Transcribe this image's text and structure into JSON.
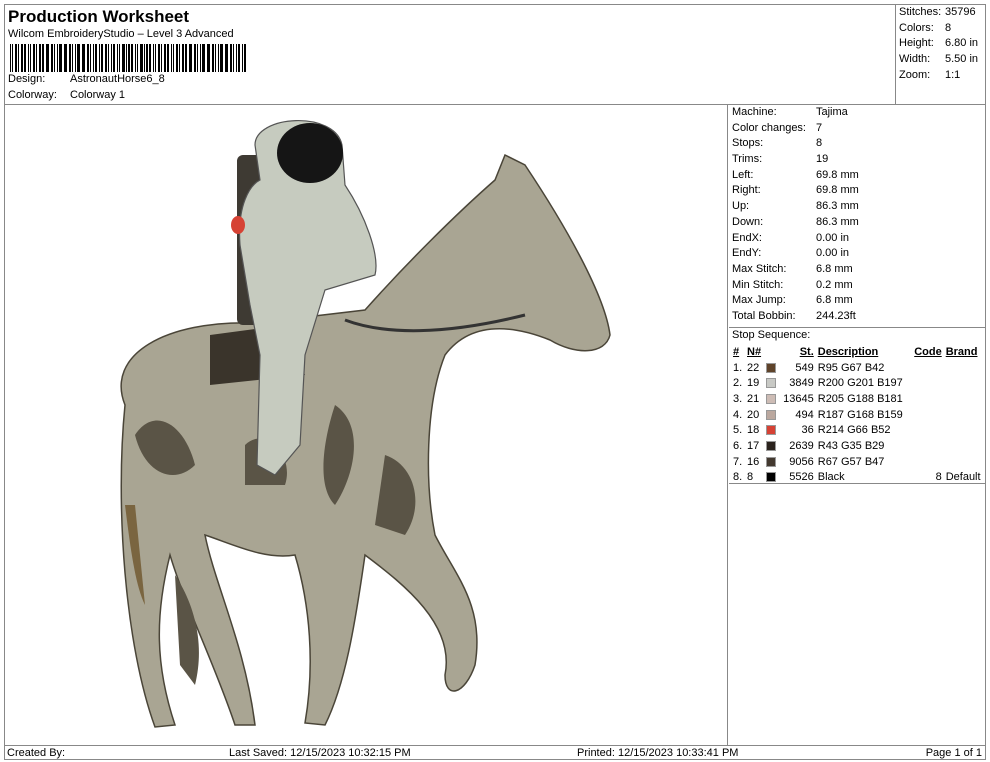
{
  "header": {
    "title": "Production Worksheet",
    "subtitle": "Wilcom EmbroideryStudio – Level 3 Advanced",
    "design_label": "Design:",
    "design": "AstronautHorse6_8",
    "colorway_label": "Colorway:",
    "colorway": "Colorway 1"
  },
  "stats": [
    {
      "k": "Stitches:",
      "v": "35796"
    },
    {
      "k": "Colors:",
      "v": "8"
    },
    {
      "k": "Height:",
      "v": "6.80 in"
    },
    {
      "k": "Width:",
      "v": "5.50 in"
    },
    {
      "k": "Zoom:",
      "v": "1:1"
    }
  ],
  "props": [
    {
      "k": "Machine:",
      "v": "Tajima"
    },
    {
      "k": "Color changes:",
      "v": "7"
    },
    {
      "k": "Stops:",
      "v": "8"
    },
    {
      "k": "Trims:",
      "v": "19"
    },
    {
      "k": "Left:",
      "v": "69.8 mm"
    },
    {
      "k": "Right:",
      "v": "69.8 mm"
    },
    {
      "k": "Up:",
      "v": "86.3 mm"
    },
    {
      "k": "Down:",
      "v": "86.3 mm"
    },
    {
      "k": "EndX:",
      "v": "0.00 in"
    },
    {
      "k": "EndY:",
      "v": "0.00 in"
    },
    {
      "k": "Max Stitch:",
      "v": "6.8 mm"
    },
    {
      "k": "Min Stitch:",
      "v": "0.2 mm"
    },
    {
      "k": "Max Jump:",
      "v": "6.8 mm"
    },
    {
      "k": "Total Bobbin:",
      "v": "244.23ft"
    }
  ],
  "stop_sequence": {
    "label": "Stop Sequence:",
    "headers": [
      "#",
      "N#",
      "St.",
      "Description",
      "Code",
      "Brand"
    ],
    "rows": [
      {
        "i": "1.",
        "n": "22",
        "color": "#5f432a",
        "st": "549",
        "desc": "R95 G67 B42",
        "code": "",
        "brand": ""
      },
      {
        "i": "2.",
        "n": "19",
        "color": "#c8c9c5",
        "st": "3849",
        "desc": "R200 G201 B197",
        "code": "",
        "brand": ""
      },
      {
        "i": "3.",
        "n": "21",
        "color": "#cdbcb5",
        "st": "13645",
        "desc": "R205 G188 B181",
        "code": "",
        "brand": ""
      },
      {
        "i": "4.",
        "n": "20",
        "color": "#bba89f",
        "st": "494",
        "desc": "R187 G168 B159",
        "code": "",
        "brand": ""
      },
      {
        "i": "5.",
        "n": "18",
        "color": "#d64234",
        "st": "36",
        "desc": "R214 G66 B52",
        "code": "",
        "brand": ""
      },
      {
        "i": "6.",
        "n": "17",
        "color": "#2b231d",
        "st": "2639",
        "desc": "R43 G35 B29",
        "code": "",
        "brand": ""
      },
      {
        "i": "7.",
        "n": "16",
        "color": "#43392f",
        "st": "9056",
        "desc": "R67 G57 B47",
        "code": "",
        "brand": ""
      },
      {
        "i": "8.",
        "n": "8",
        "color": "#000000",
        "st": "5526",
        "desc": "Black",
        "code": "8",
        "brand": "Default"
      }
    ]
  },
  "footer": {
    "created": "Created By:",
    "saved": "Last Saved: 12/15/2023 10:32:15 PM",
    "printed": "Printed: 12/15/2023 10:33:41 PM",
    "page": "Page 1 of 1"
  }
}
